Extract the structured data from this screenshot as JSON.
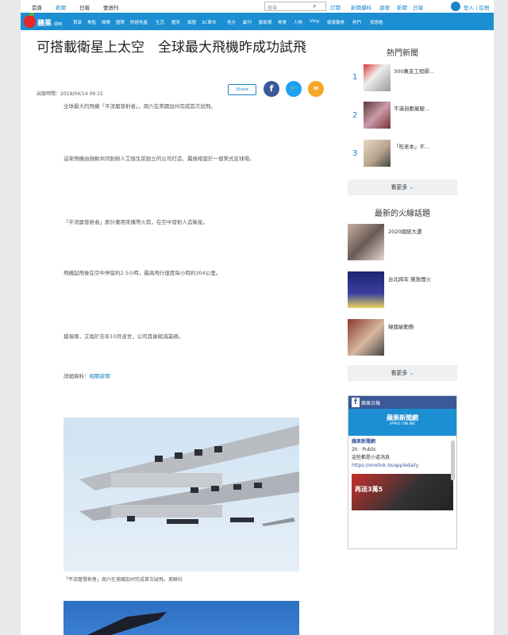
{
  "topbar": {
    "links": [
      "首頁",
      "新聞",
      "日報",
      "壹週刊"
    ],
    "search_placeholder": "搜尋",
    "search_icon": "search-icon",
    "right_links": [
      "訂閱",
      "新聞爆料",
      "論壇",
      "新聞",
      "日報"
    ],
    "login": "登入 | 註冊"
  },
  "nav": {
    "logo_text": "蘋果",
    "logo_sub": "即時",
    "items": [
      "首頁",
      "焦點",
      "娛樂",
      "國際",
      "財經地產",
      "生活",
      "體育",
      "論壇",
      "3C車市",
      "地方",
      "副刊",
      "動新聞",
      "美食",
      "人物",
      "Vlog",
      "健康醫美",
      "熱門",
      "我想看"
    ]
  },
  "article": {
    "title": "可搭載衛星上太空　全球最大飛機昨成功試飛",
    "date": "出版時間：2019/04/14 09:15",
    "share_label": "Share",
    "paragraphs": [
      "全球最大的飛機「平流層發射者」，周六在美國加州完成首次試飛。",
      "這架飛機由微軟共同創辦人艾倫生前創立的公司打造，翼展相當於一個美式足球場。",
      "「平流層發射者」原計畫用來攜帶火箭，在空中發射人造衛星。",
      "飛機起飛後在空中停留約2.5小時，最高飛行速度每小時約304公里。",
      "據報導，艾倫於去年10月逝世，公司其後縮減業務。",
      "詳細資料"
    ],
    "link_text": "相關新聞",
    "caption": "「平流層發射者」周六在美國加州完成首次試飛。美聯社"
  },
  "sidebar": {
    "hot_title": "熱門新聞",
    "hot_items": [
      {
        "num": "1",
        "text": "300萬支工程師…"
      },
      {
        "num": "2",
        "text": "不滿自動駕駛…"
      },
      {
        "num": "3",
        "text": "「吃老本」不…"
      }
    ],
    "more_label": "看更多",
    "fire_title": "最新的火線話題",
    "fire_items": [
      "2020總統大選",
      "台北跨年 施放煙火",
      "韓國瑜動態"
    ],
    "fb": {
      "header": "蘋果日報",
      "cover_title": "蘋果新聞網",
      "cover_sub": "APPLE ONLINE",
      "page_name": "蘋果新聞網",
      "page_meta": "2h · Public",
      "post": "這些都是小道消息",
      "link": "https://onelink.to/appledaily",
      "promo": "再送3萬5"
    }
  }
}
